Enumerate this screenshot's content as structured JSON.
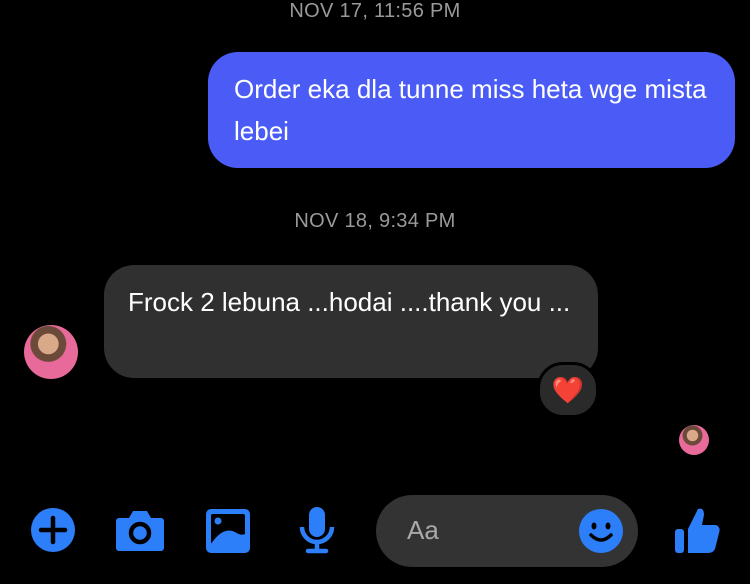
{
  "conversation": {
    "timestamps": [
      "NOV 17, 11:56 PM",
      "NOV 18, 9:34 PM"
    ],
    "messages": [
      {
        "direction": "outgoing",
        "text": "Order eka dla tunne miss heta wge mista lebei"
      },
      {
        "direction": "incoming",
        "text": "Frock  2 lebuna ...hodai ....thank you ...",
        "reaction": "❤️"
      }
    ]
  },
  "composer": {
    "placeholder": "Aa",
    "icons": [
      "plus-icon",
      "camera-icon",
      "image-icon",
      "microphone-icon",
      "emoji-icon",
      "thumbs-up-icon"
    ]
  },
  "colors": {
    "accent": "#2d7ff9",
    "outgoing_bubble": "#4b5cf6",
    "incoming_bubble": "#303030"
  }
}
